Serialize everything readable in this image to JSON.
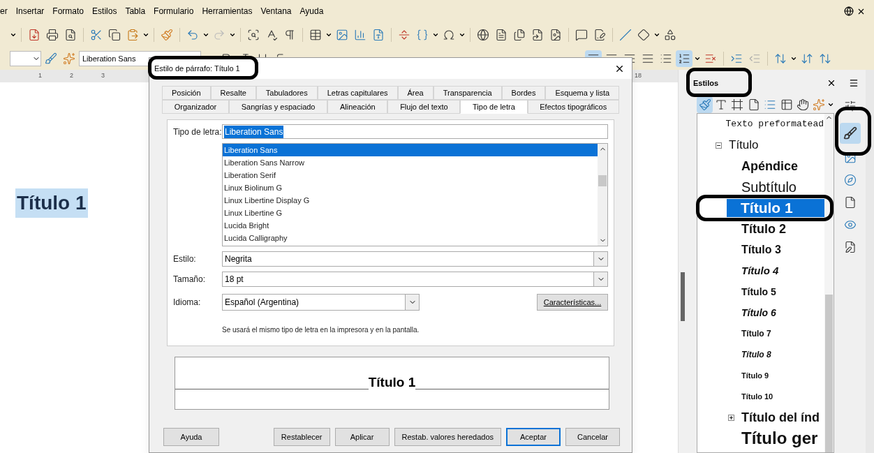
{
  "menu_bar": {
    "items": [
      "er",
      "Insertar",
      "Formato",
      "Estilos",
      "Tabla",
      "Formulario",
      "Herramientas",
      "Ventana",
      "Ayuda"
    ]
  },
  "formatting_bar": {
    "font_name": "Liberation Sans"
  },
  "ruler": {
    "labels": [
      "1",
      "2",
      "3"
    ],
    "right_label": "18"
  },
  "document": {
    "heading": "Título 1"
  },
  "dialog": {
    "title": "Estilo de párrafo: Título 1",
    "tab_rows": [
      {
        "tabs": [
          {
            "label": "Posición",
            "selected": false
          },
          {
            "label": "Resalte",
            "selected": false
          },
          {
            "label": "Tabuladores",
            "selected": false
          },
          {
            "label": "Letras capitulares",
            "selected": false
          },
          {
            "label": "Área",
            "selected": false
          },
          {
            "label": "Transparencia",
            "selected": false
          },
          {
            "label": "Bordes",
            "selected": false
          },
          {
            "label": "Esquema y lista",
            "selected": false
          }
        ]
      },
      {
        "tabs": [
          {
            "label": "Organizador",
            "selected": false
          },
          {
            "label": "Sangrías y espaciado",
            "selected": false
          },
          {
            "label": "Alineación",
            "selected": false
          },
          {
            "label": "Flujo del texto",
            "selected": false
          },
          {
            "label": "Tipo de letra",
            "selected": true
          },
          {
            "label": "Efectos tipográficos",
            "selected": false
          }
        ]
      }
    ],
    "font_field": {
      "label": "Tipo de letra:",
      "value": "Liberation Sans"
    },
    "font_list": [
      {
        "label": "Liberation Sans",
        "selected": true
      },
      {
        "label": "Liberation Sans Narrow",
        "selected": false
      },
      {
        "label": "Liberation Serif",
        "selected": false
      },
      {
        "label": "Linux Biolinum G",
        "selected": false
      },
      {
        "label": "Linux Libertine Display G",
        "selected": false
      },
      {
        "label": "Linux Libertine G",
        "selected": false
      },
      {
        "label": "Lucida Bright",
        "selected": false
      },
      {
        "label": "Lucida Calligraphy",
        "selected": false
      }
    ],
    "style_field": {
      "label": "Estilo:",
      "value": "Negrita"
    },
    "size_field": {
      "label": "Tamaño:",
      "value": "18 pt"
    },
    "language_field": {
      "label": "Idioma:",
      "value": "Español (Argentina)"
    },
    "features_button": "Características...",
    "note": "Se usará el mismo tipo de letra en la impresora y en la pantalla.",
    "preview": "Título 1",
    "help_button": "Ayuda",
    "buttons": [
      {
        "label": "Restablecer",
        "default": false
      },
      {
        "label": "Aplicar",
        "default": false
      },
      {
        "label": "Restab. valores heredados",
        "default": false
      },
      {
        "label": "Aceptar",
        "default": true
      },
      {
        "label": "Cancelar",
        "default": false
      }
    ]
  },
  "sidebar": {
    "title": "Estilos",
    "items": [
      {
        "label": "Texto preformatead",
        "kind": "mono",
        "selected": false
      },
      {
        "label": "Título",
        "kind": "regular-lg",
        "selected": false,
        "expanded": true,
        "children": [
          {
            "label": "Apéndice",
            "kind": "bold-lg",
            "selected": false
          },
          {
            "label": "Subtítulo",
            "kind": "regular-xl",
            "selected": false
          },
          {
            "label": "Título 1",
            "kind": "bold-xl",
            "selected": true
          },
          {
            "label": "Título 2",
            "kind": "bold-lg",
            "selected": false
          },
          {
            "label": "Título 3",
            "kind": "bold-md",
            "selected": false
          },
          {
            "label": "Título 4",
            "kind": "bold-italic-md",
            "selected": false
          },
          {
            "label": "Título 5",
            "kind": "bold-sm",
            "selected": false
          },
          {
            "label": "Título 6",
            "kind": "bold-italic-sm",
            "selected": false
          },
          {
            "label": "Título 7",
            "kind": "bold-xs",
            "selected": false
          },
          {
            "label": "Título 8",
            "kind": "bold-italic-xs",
            "selected": false
          },
          {
            "label": "Título 9",
            "kind": "bold-xxs",
            "selected": false
          },
          {
            "label": "Título 10",
            "kind": "bold-xxs",
            "selected": false
          },
          {
            "label": "Título del índ",
            "kind": "bold-lg",
            "selected": false,
            "expanded": false
          },
          {
            "label": "Título ger",
            "kind": "bold-2xl",
            "selected": false
          }
        ]
      }
    ]
  }
}
